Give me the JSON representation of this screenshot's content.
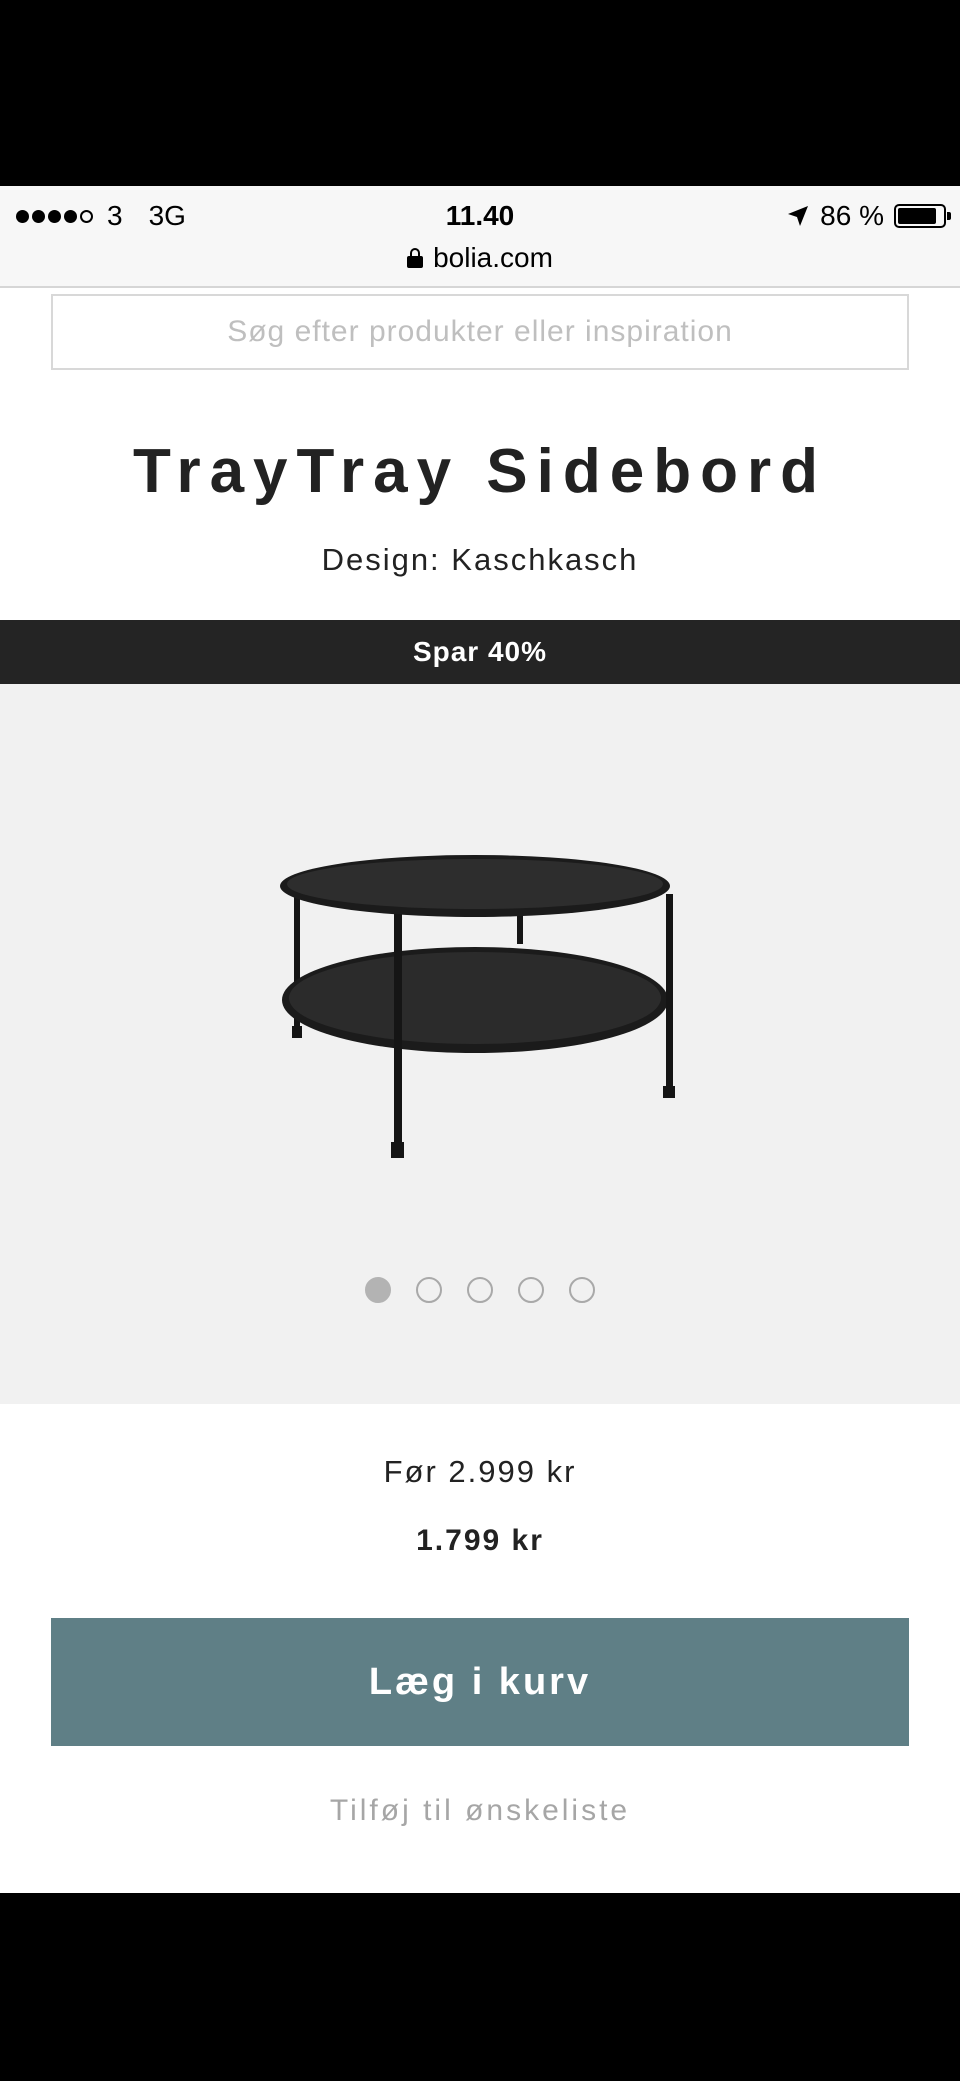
{
  "status_bar": {
    "carrier": "3",
    "network": "3G",
    "time": "11.40",
    "battery_percent": "86 %",
    "battery_level": 0.86
  },
  "browser": {
    "url": "bolia.com"
  },
  "search": {
    "placeholder": "Søg efter produkter eller inspiration"
  },
  "product": {
    "title": "TrayTray Sidebord",
    "designer": "Design: Kaschkasch",
    "promo": "Spar 40%",
    "price_before": "Før 2.999 kr",
    "price_now": "1.799 kr",
    "image_count": 5,
    "active_image": 1
  },
  "actions": {
    "add_to_cart": "Læg i kurv",
    "add_to_wishlist": "Tilføj til ønskeliste"
  },
  "colors": {
    "promo_bar": "#242424",
    "cart_button": "#5f7f86",
    "gallery_bg": "#f1f1f1"
  }
}
